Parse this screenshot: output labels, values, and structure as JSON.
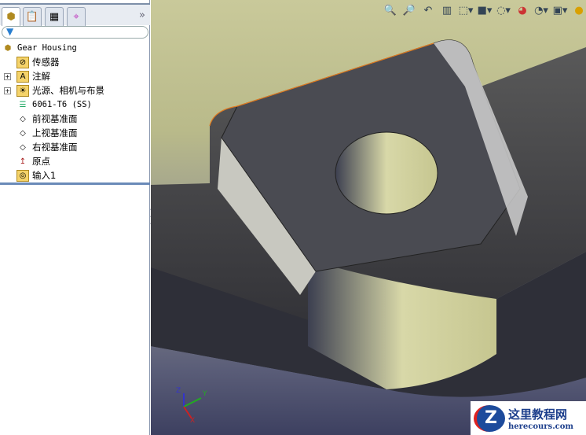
{
  "tree": {
    "root": "Gear Housing",
    "items": [
      {
        "label": "传感器",
        "icon": "sensor-folder-icon",
        "expandable": false
      },
      {
        "label": "注解",
        "icon": "annotation-folder-icon",
        "expandable": true
      },
      {
        "label": "光源、相机与布景",
        "icon": "lights-folder-icon",
        "expandable": true
      },
      {
        "label": "6061-T6 (SS)",
        "icon": "material-icon",
        "expandable": false
      },
      {
        "label": "前视基准面",
        "icon": "plane-icon",
        "expandable": false
      },
      {
        "label": "上视基准面",
        "icon": "plane-icon",
        "expandable": false
      },
      {
        "label": "右视基准面",
        "icon": "plane-icon",
        "expandable": false
      },
      {
        "label": "原点",
        "icon": "origin-icon",
        "expandable": false
      },
      {
        "label": "输入1",
        "icon": "imported-body-icon",
        "expandable": false
      }
    ]
  },
  "tabs": [
    "FeatureManager",
    "PropertyManager",
    "ConfigurationManager",
    "DimXpertManager"
  ],
  "more": "»",
  "watermark": {
    "title": "这里教程网",
    "url": "herecours.com"
  },
  "triad": {
    "x": "X",
    "y": "Y",
    "z": "Z"
  }
}
